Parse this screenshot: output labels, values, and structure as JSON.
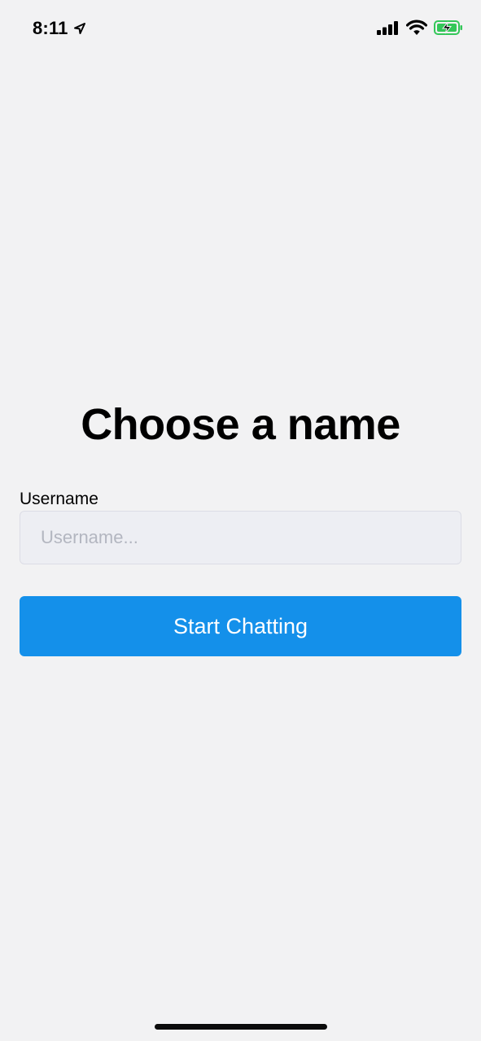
{
  "status_bar": {
    "time": "8:11",
    "icons": [
      "location-arrow-icon",
      "cellular-signal-icon",
      "wifi-icon",
      "battery-charging-icon"
    ],
    "battery_color": "#34c759"
  },
  "main": {
    "title": "Choose a name",
    "username_label": "Username",
    "username_placeholder": "Username...",
    "username_value": "",
    "start_button_label": "Start Chatting"
  },
  "colors": {
    "background": "#f2f2f3",
    "input_background": "#edeef3",
    "primary_button": "#1490ea",
    "button_text": "#ffffff"
  }
}
